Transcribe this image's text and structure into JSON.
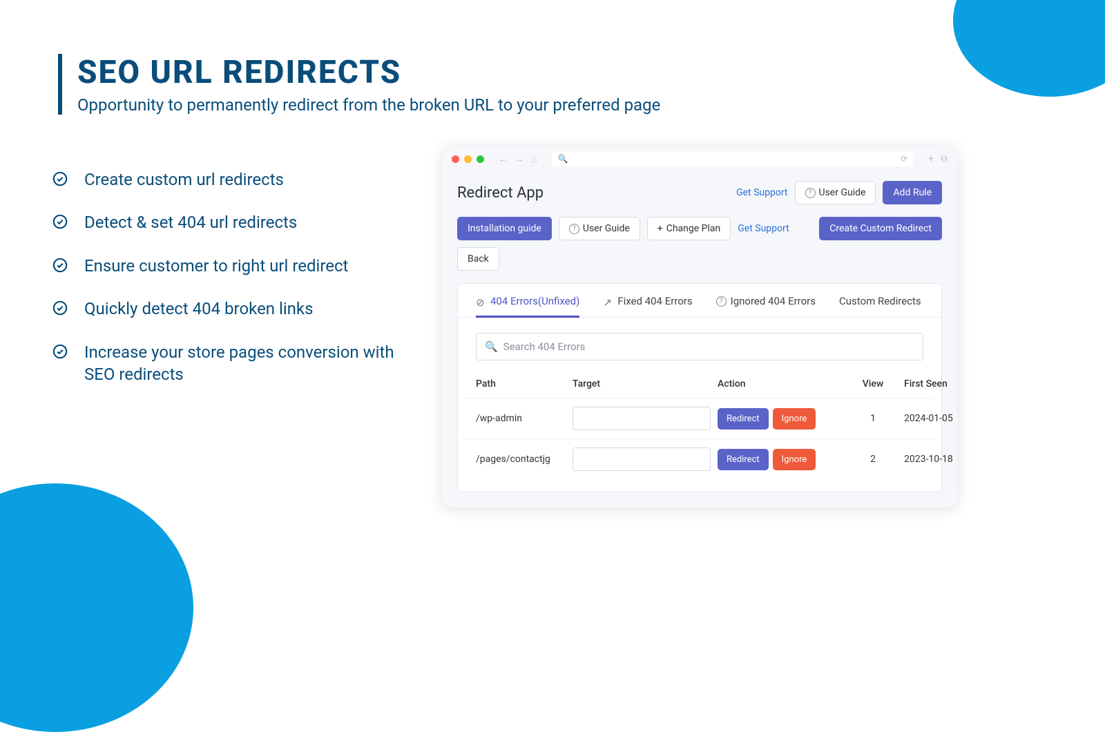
{
  "hero": {
    "title": "SEO URL REDIRECTS",
    "subtitle": "Opportunity to permanently redirect from the broken URL to your preferred page"
  },
  "features": [
    "Create custom url redirects",
    "Detect & set 404 url redirects",
    "Ensure customer to right url redirect",
    "Quickly detect 404 broken links",
    "Increase your store pages conversion with SEO redirects"
  ],
  "app": {
    "title": "Redirect App",
    "head_actions": {
      "get_support": "Get Support",
      "user_guide": "User Guide",
      "add_rule": "Add Rule"
    },
    "toolbar": {
      "installation_guide": "Installation guide",
      "user_guide": "User Guide",
      "change_plan": "Change Plan",
      "get_support": "Get Support",
      "create_custom_redirect": "Create Custom Redirect",
      "back": "Back"
    },
    "tabs": {
      "unfixed": "404 Errors(Unfixed)",
      "fixed": "Fixed 404 Errors",
      "ignored": "Ignored 404 Errors",
      "custom": "Custom Redirects"
    },
    "search_placeholder": "Search 404 Errors",
    "table": {
      "headers": {
        "path": "Path",
        "target": "Target",
        "action": "Action",
        "view": "View",
        "first_seen": "First Seen"
      },
      "action_redirect": "Redirect",
      "action_ignore": "Ignore",
      "rows": [
        {
          "path": "/wp-admin",
          "target": "",
          "view": "1",
          "first_seen": "2024-01-05"
        },
        {
          "path": "/pages/contactjg",
          "target": "",
          "view": "2",
          "first_seen": "2023-10-18"
        }
      ]
    }
  }
}
